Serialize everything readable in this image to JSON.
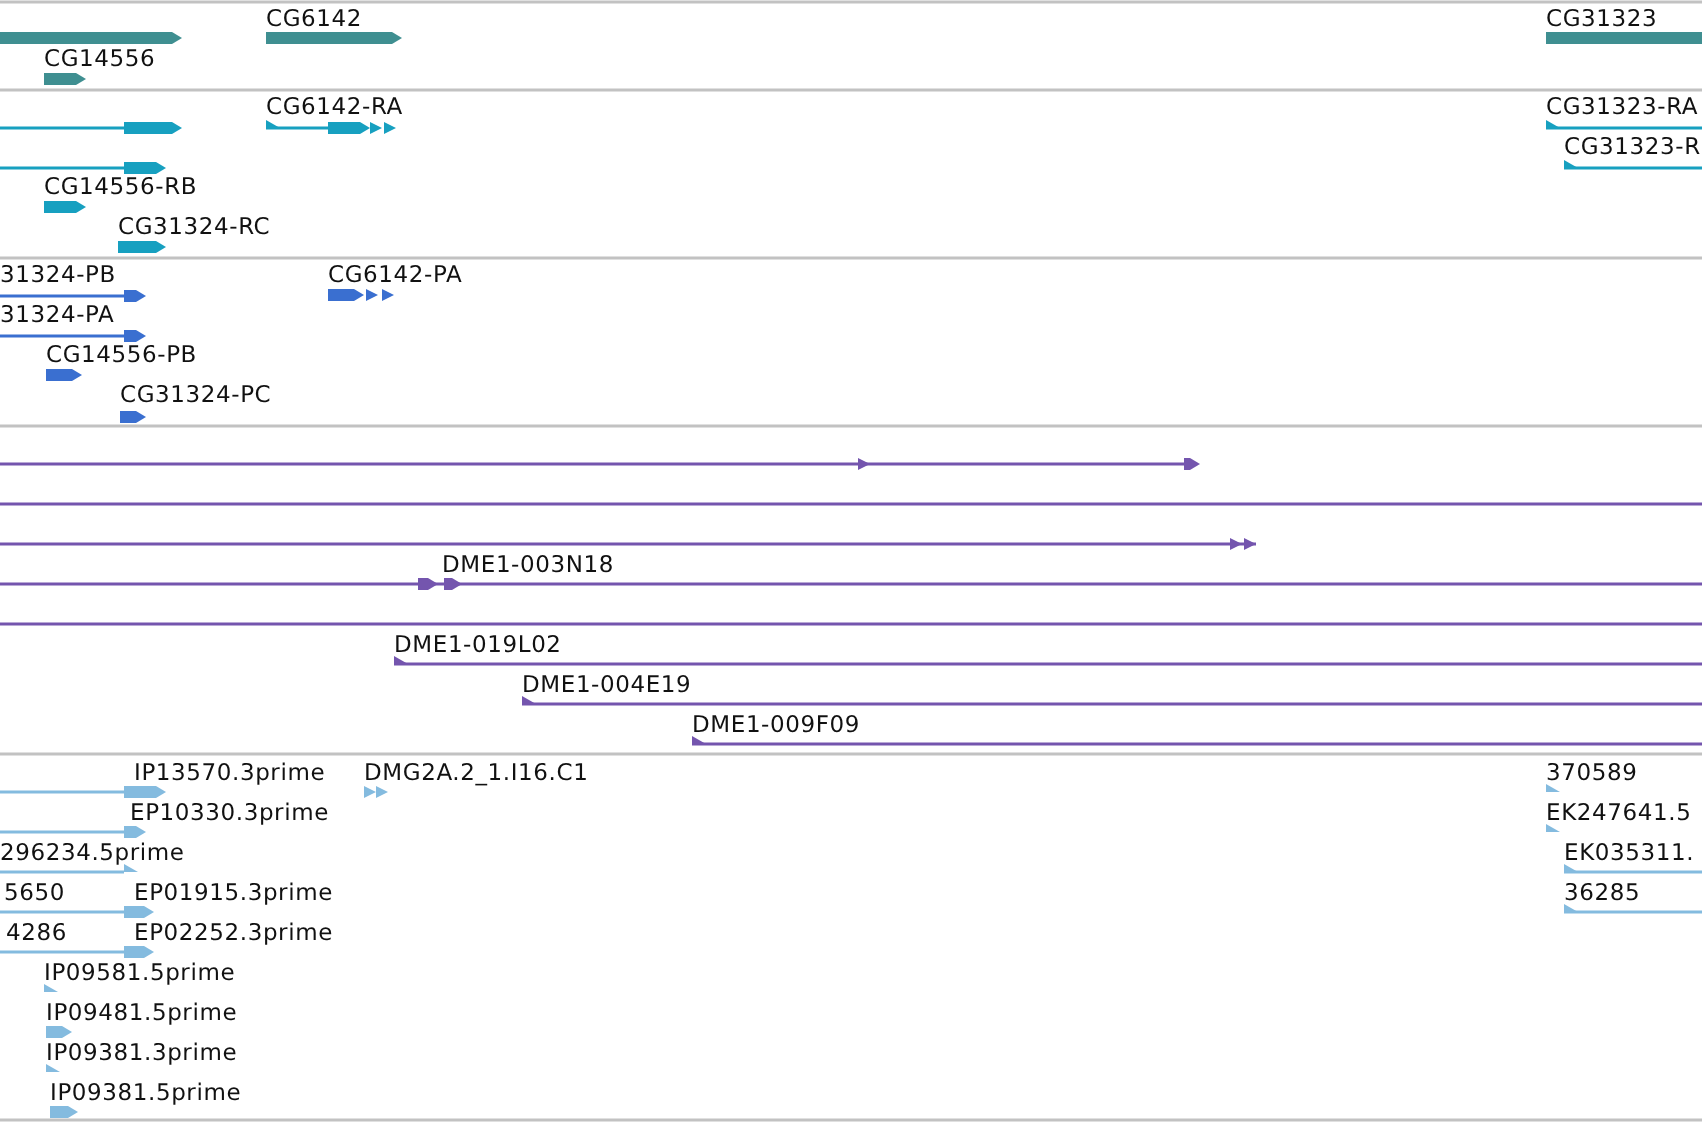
{
  "tracks": [
    {
      "labels": [
        "CG6142",
        "CG14556",
        "CG31323"
      ]
    },
    {
      "labels": [
        "CG6142-RA",
        "CG14556-RB",
        "CG31324-RC",
        "CG31323-RA",
        "CG31323-R"
      ]
    },
    {
      "labels": [
        "31324-PB",
        "CG6142-PA",
        "31324-PA",
        "CG14556-PB",
        "CG31324-PC"
      ]
    },
    {
      "labels": [
        "DME1-003N18",
        "DME1-019L02",
        "DME1-004E19",
        "DME1-009F09"
      ]
    },
    {
      "labels": [
        "IP13570.3prime",
        "DMG2A.2_1.I16.C1",
        "370589",
        "EP10330.3prime",
        "EK247641.5",
        "296234.5prime",
        "EK035311.",
        "5650",
        "EP01915.3prime",
        "36285",
        "4286",
        "EP02252.3prime",
        "IP09581.5prime",
        "IP09481.5prime",
        "IP09381.3prime",
        "IP09381.5prime"
      ]
    }
  ]
}
